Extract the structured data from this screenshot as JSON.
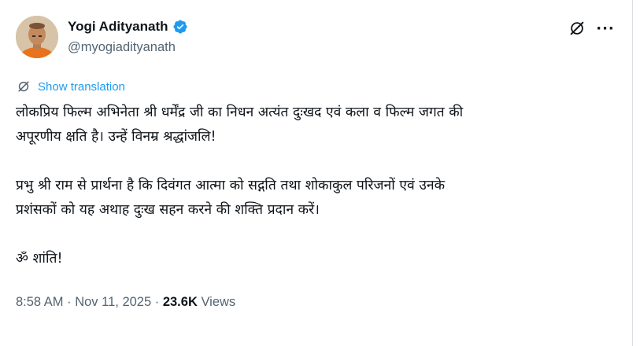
{
  "author": {
    "display_name": "Yogi Adityanath",
    "handle": "@myogiadityanath",
    "verified": true,
    "avatar_icon": "avatar-photo"
  },
  "actions": {
    "grok_icon": "grok-icon",
    "more_icon": "more-options-icon",
    "more_glyph": "···"
  },
  "translation": {
    "label": "Show translation",
    "icon": "translate-icon"
  },
  "tweet": {
    "line1": "लोकप्रिय फिल्म अभिनेता श्री धर्मेंद्र जी का निधन अत्यंत दुःखद एवं कला व फिल्म जगत की",
    "line2": "अपूरणीय क्षति है। उन्हें विनम्र श्रद्धांजलि!",
    "line3": "प्रभु श्री राम से प्रार्थना है कि दिवंगत आत्मा को सद्गति तथा शोकाकुल परिजनों एवं उनके",
    "line4": "प्रशंसकों को यह अथाह दुःख सहन करने की शक्ति प्रदान करें।",
    "line5": "ॐ शांति!"
  },
  "meta": {
    "time": "8:58 AM",
    "separator": " · ",
    "date": "Nov 11, 2025",
    "views_count": "23.6K",
    "views_label": " Views"
  },
  "colors": {
    "text": "#0f1419",
    "secondary": "#536471",
    "link": "#1d9bf0",
    "verified": "#1d9bf0"
  }
}
